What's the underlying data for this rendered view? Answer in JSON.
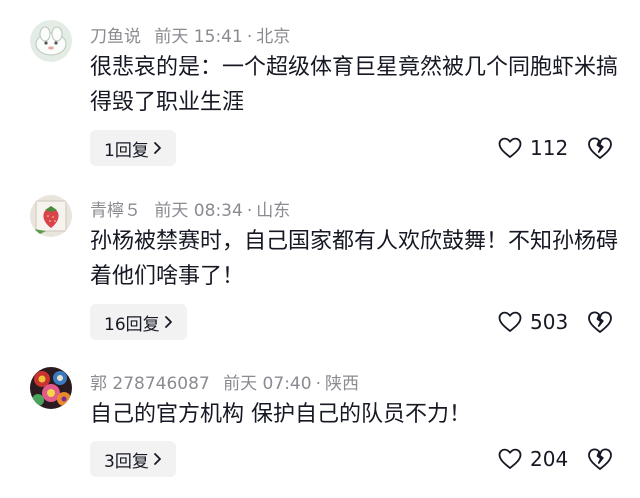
{
  "comments": [
    {
      "username": "刀鱼说",
      "time": "前天 15:41",
      "location": "北京",
      "text": "很悲哀的是：一个超级体育巨星竟然被几个同胞虾米搞得毁了职业生涯",
      "replies_label": "1回复",
      "likes": "112",
      "avatar_icon": "white-creature-avatar"
    },
    {
      "username": "青檸５",
      "time": "前天 08:34",
      "location": "山东",
      "text": "孙杨被禁赛时，自己国家都有人欢欣鼓舞！不知孙杨碍着他们啥事了！",
      "replies_label": "16回复",
      "likes": "503",
      "avatar_icon": "strawberry-avatar"
    },
    {
      "username": "郭 278746087",
      "time": "前天 07:40",
      "location": "陕西",
      "text": "自己的官方机构 保护自己的队员不力！",
      "replies_label": "3回复",
      "likes": "204",
      "avatar_icon": "floral-pattern-avatar"
    }
  ],
  "separator": "·",
  "colors": {
    "meta": "#8a8b91",
    "text": "#161823",
    "reply_bg": "#f2f2f3"
  }
}
